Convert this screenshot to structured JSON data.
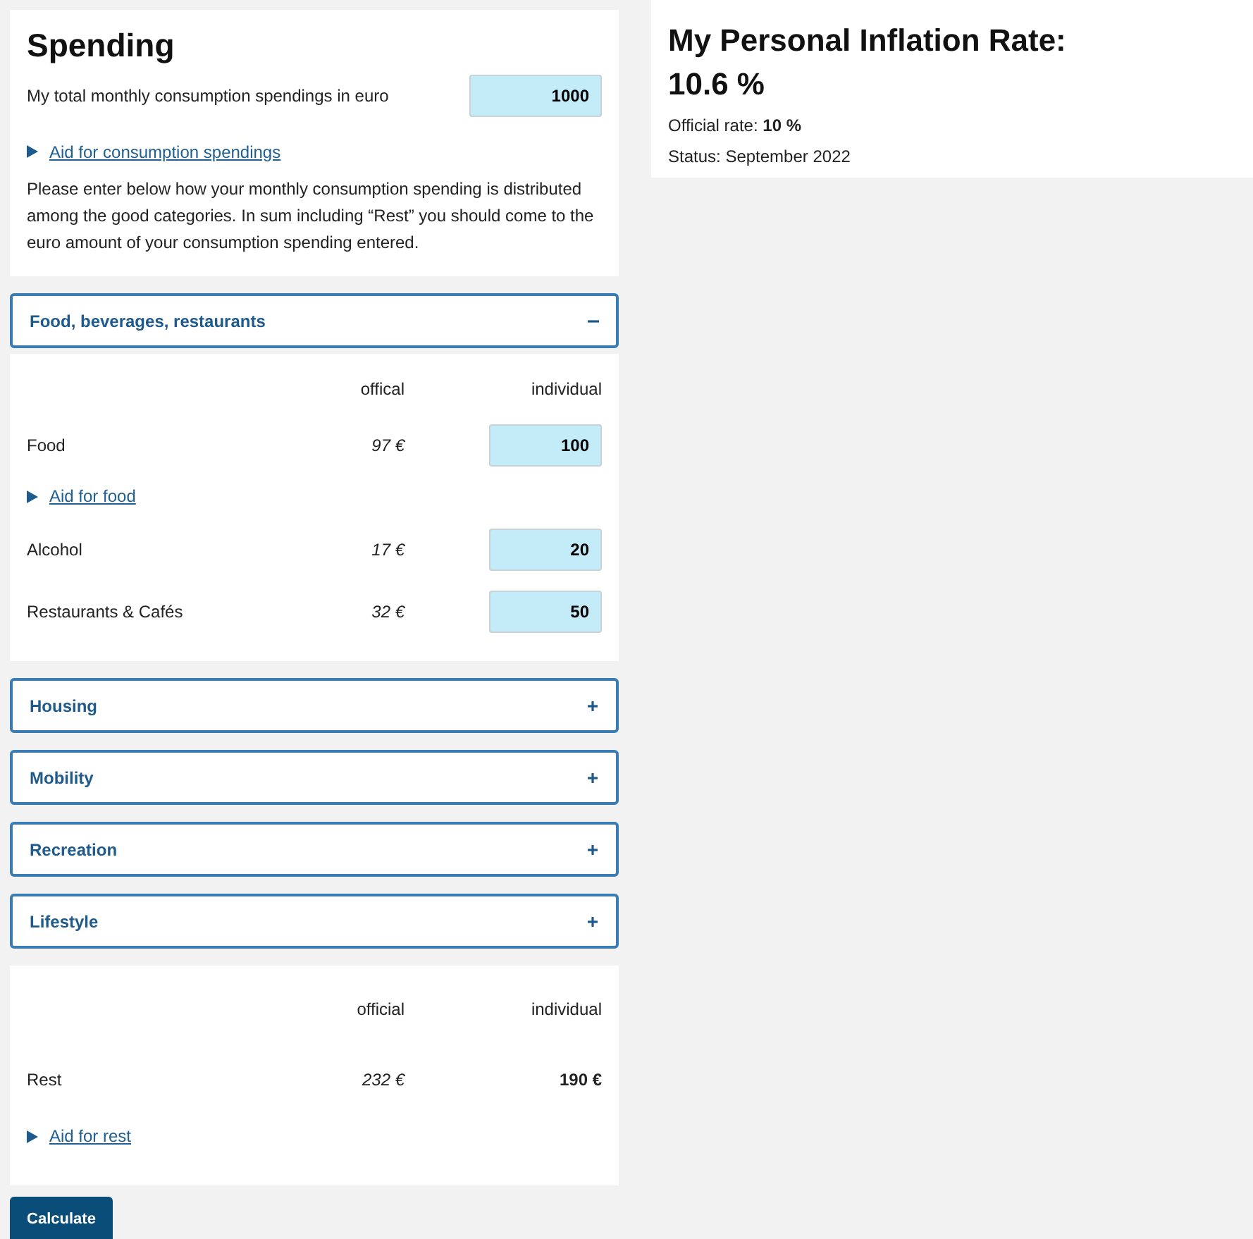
{
  "spending": {
    "title": "Spending",
    "total_label": "My total monthly consumption spendings in euro",
    "total_value": "1000",
    "aid_link": "Aid for consumption spendings",
    "instructions": "Please enter below how your monthly consumption spending is distributed among the good categories. In sum including “Rest” you should come to the euro amount of your consumption spending entered."
  },
  "categories": [
    {
      "title": "Food, beverages, restaurants",
      "expanded": true,
      "col_official": "offical",
      "col_individual": "individual",
      "items": [
        {
          "kind": "input",
          "label": "Food",
          "official": "97 €",
          "value": "100"
        },
        {
          "kind": "aid",
          "label": "Aid for food"
        },
        {
          "kind": "input",
          "label": "Alcohol",
          "official": "17 €",
          "value": "20"
        },
        {
          "kind": "input",
          "label": "Restaurants & Cafés",
          "official": "32 €",
          "value": "50"
        }
      ]
    },
    {
      "title": "Housing",
      "expanded": false
    },
    {
      "title": "Mobility",
      "expanded": false
    },
    {
      "title": "Recreation",
      "expanded": false
    },
    {
      "title": "Lifestyle",
      "expanded": false
    }
  ],
  "rest": {
    "col_official": "official",
    "col_individual": "individual",
    "label": "Rest",
    "official": "232 €",
    "individual": "190 €",
    "aid_link": "Aid for rest"
  },
  "calculate_button": "Calculate",
  "result": {
    "title": "My Personal Inflation Rate:",
    "rate": "10.6 %",
    "official_rate": "Official rate: **10 %**",
    "status": "Status: September 2022"
  }
}
